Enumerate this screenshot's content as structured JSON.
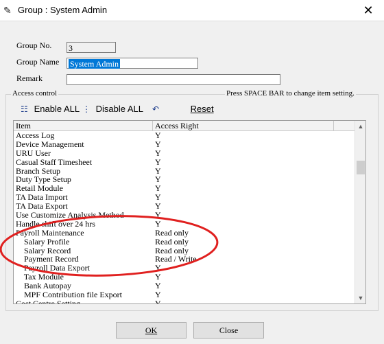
{
  "window": {
    "title": "Group : System Admin",
    "close_glyph": "✕"
  },
  "form": {
    "group_no_label": "Group No.",
    "group_no_value": "3",
    "group_name_label": "Group Name",
    "group_name_value": "System Admin",
    "remark_label": "Remark",
    "remark_value": ""
  },
  "access": {
    "legend": "Access control",
    "hint": "Press SPACE BAR to change item setting.",
    "enable_all": "Enable ALL",
    "disable_all": "Disable ALL",
    "reset": "Reset"
  },
  "grid": {
    "headers": [
      "Item",
      "Access Right"
    ],
    "rows": [
      [
        "Access Log",
        "Y"
      ],
      [
        "Device Management",
        "Y"
      ],
      [
        "URU User",
        "Y"
      ],
      [
        "Casual Staff Timesheet",
        "Y"
      ],
      [
        "Branch Setup",
        "Y"
      ],
      [
        "Duty Type Setup",
        "Y"
      ],
      [
        "Retail Module",
        "Y"
      ],
      [
        "TA Data Import",
        "Y"
      ],
      [
        "TA Data Export",
        "Y"
      ],
      [
        "Use Customize Analysis Method",
        "Y"
      ],
      [
        "Handle shift over 24 hrs",
        "Y"
      ],
      [
        "Payroll Maintenance",
        "Read only"
      ],
      [
        "    Salary Profile",
        "Read only"
      ],
      [
        "    Salary Record",
        "Read only"
      ],
      [
        "    Payment Record",
        "Read / Write"
      ],
      [
        "    Payroll Data Export",
        "Y"
      ],
      [
        "    Tax Module",
        "Y"
      ],
      [
        "    Bank Autopay",
        "Y"
      ],
      [
        "    MPF Contribution file Export",
        "Y"
      ],
      [
        "Cost Centre Setting",
        "Y"
      ]
    ]
  },
  "buttons": {
    "ok": "OK",
    "close": "Close"
  },
  "annotation": {
    "color": "#e0201f"
  }
}
